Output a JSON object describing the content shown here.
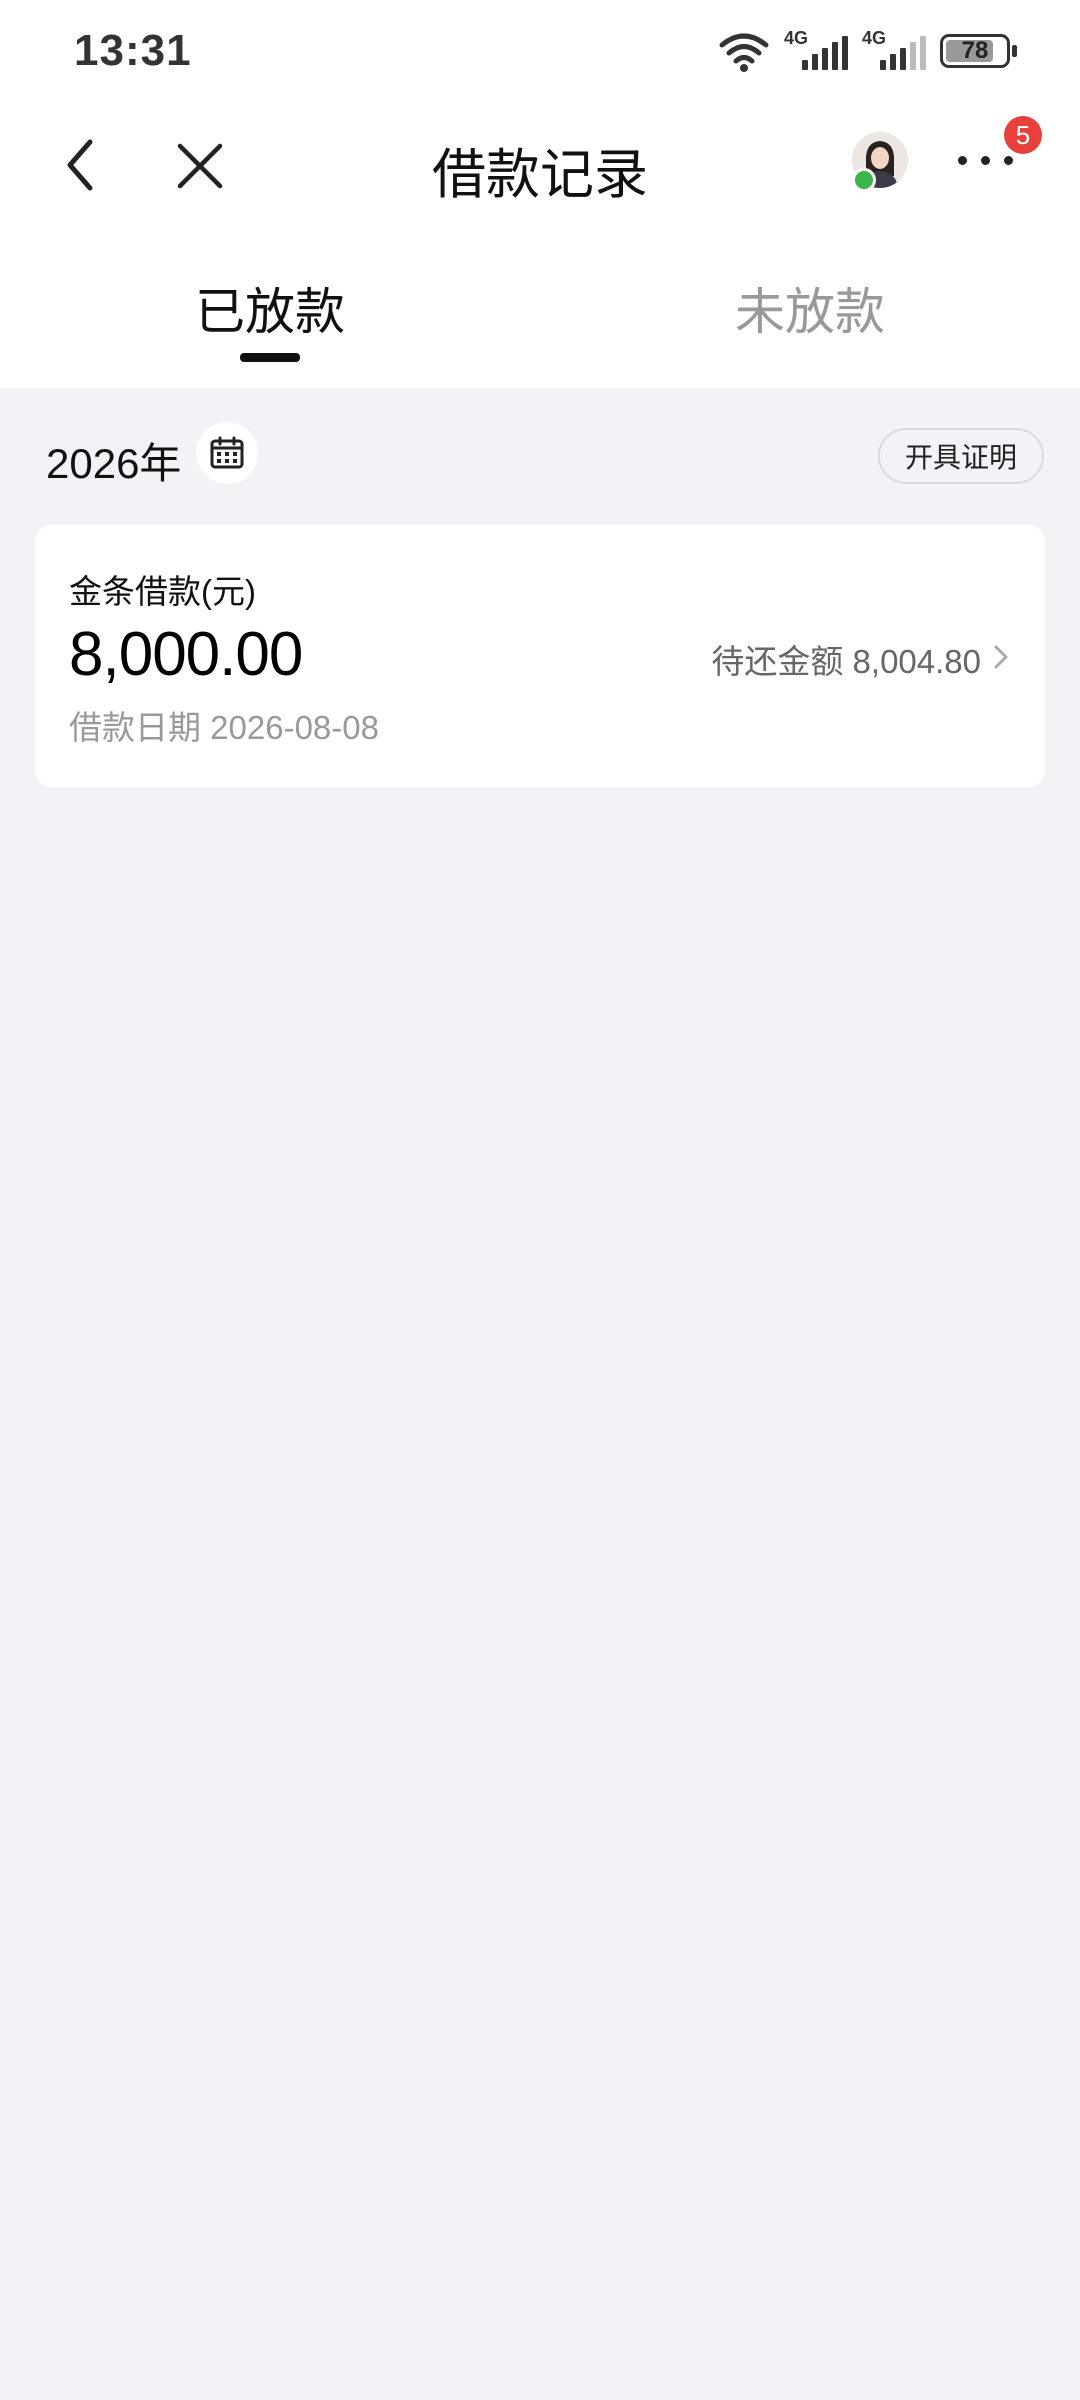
{
  "status_bar": {
    "time": "13:31",
    "network1": "4G",
    "network2": "4G",
    "battery": "78",
    "icons": [
      "wifi-icon",
      "signal-icon",
      "signal-icon",
      "battery-icon"
    ]
  },
  "navbar": {
    "title": "借款记录",
    "badge_count": "5",
    "icons": [
      "back-icon",
      "close-icon",
      "avatar",
      "more-icon"
    ]
  },
  "tabs": [
    {
      "label": "已放款",
      "active": true
    },
    {
      "label": "未放款",
      "active": false
    }
  ],
  "filter": {
    "year": "2026年",
    "certificate_button": "开具证明",
    "icon": "calendar-icon"
  },
  "loans": [
    {
      "title": "金条借款(元)",
      "amount": "8,000.00",
      "pending": "待还金额 8,004.80",
      "date": "借款日期 2026-08-08"
    }
  ],
  "colors": {
    "page_background": "#f2f2f7",
    "card_background": "#ffffff",
    "badge": "#e8413c",
    "muted_text": "#999999"
  }
}
